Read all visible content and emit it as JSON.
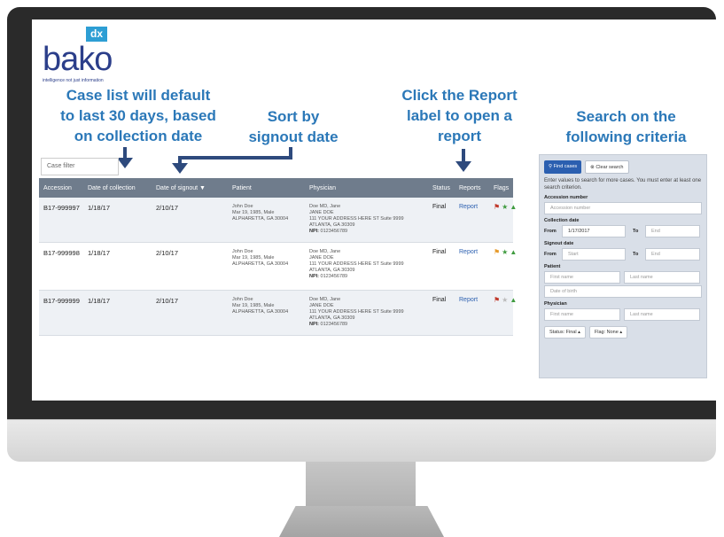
{
  "brand": {
    "badge": "dx",
    "wordmark": "bako",
    "tagline": "intelligence not just information",
    "colors": {
      "navy": "#2b3e8a",
      "cyan": "#2d9ed4",
      "callout": "#2b78b8"
    }
  },
  "callouts": {
    "default_range": [
      "Case list will default",
      "to last 30 days, based",
      "on collection date"
    ],
    "sort": [
      "Sort by",
      "signout date"
    ],
    "report": [
      "Click the Report",
      "label to open a",
      "report"
    ],
    "search": [
      "Search on the",
      "following criteria"
    ]
  },
  "case_filter": {
    "placeholder": "Case filter"
  },
  "table": {
    "columns": [
      "Accession",
      "Date of collection",
      "Date of signout",
      "Patient",
      "Physician",
      "Status",
      "Reports",
      "Flags"
    ],
    "sort_caret": "▼",
    "rows": [
      {
        "accession": "B17-999997",
        "collection": "1/18/17",
        "signout": "2/10/17",
        "patient": [
          "John Doe",
          "Mar 19, 1985, Male",
          "ALPHARETTA, GA 30004"
        ],
        "physician": [
          "Doe MD, Jane",
          "JANE DOE",
          "111 YOUR ADDRESS HERE ST Suite 9999",
          "ATLANTA, GA 30309"
        ],
        "npi_label": "NPI:",
        "npi": "0123456789",
        "status": "Final",
        "report": "Report",
        "flag_color": "red",
        "star": "green"
      },
      {
        "accession": "B17-999998",
        "collection": "1/18/17",
        "signout": "2/10/17",
        "patient": [
          "John Doe",
          "Mar 19, 1985, Male",
          "ALPHARETTA, GA 30004"
        ],
        "physician": [
          "Doe MD, Jane",
          "JANE DOE",
          "111 YOUR ADDRESS HERE ST Suite 9999",
          "ATLANTA, GA 30309"
        ],
        "npi_label": "NPI:",
        "npi": "0123456789",
        "status": "Final",
        "report": "Report",
        "flag_color": "orange",
        "star": "green"
      },
      {
        "accession": "B17-999999",
        "collection": "1/18/17",
        "signout": "2/10/17",
        "patient": [
          "John Doe",
          "Mar 19, 1985, Male",
          "ALPHARETTA, GA 30004"
        ],
        "physician": [
          "Doe MD, Jane",
          "JANE DOE",
          "111 YOUR ADDRESS HERE ST Suite 9999",
          "ATLANTA, GA 30309"
        ],
        "npi_label": "NPI:",
        "npi": "0123456789",
        "status": "Final",
        "report": "Report",
        "flag_color": "red",
        "star": "gray"
      }
    ]
  },
  "search": {
    "find_label": "Find cases",
    "clear_label": "Clear search",
    "hint": "Enter values to search for more cases. You must enter at least one search criterion.",
    "accession": {
      "label": "Accession number",
      "placeholder": "Accession number"
    },
    "collection": {
      "label": "Collection date",
      "from_label": "From",
      "from_value": "1/17/2017",
      "to_label": "To",
      "to_placeholder": "End"
    },
    "signout": {
      "label": "Signout date",
      "from_label": "From",
      "from_placeholder": "Start",
      "to_label": "To",
      "to_placeholder": "End"
    },
    "patient": {
      "label": "Patient",
      "first": "First name",
      "last": "Last name",
      "dob": "Date of birth"
    },
    "physician": {
      "label": "Physician",
      "first": "First name",
      "last": "Last name"
    },
    "status_dropdown": "Status: Final",
    "flag_dropdown": "Flag: None"
  }
}
